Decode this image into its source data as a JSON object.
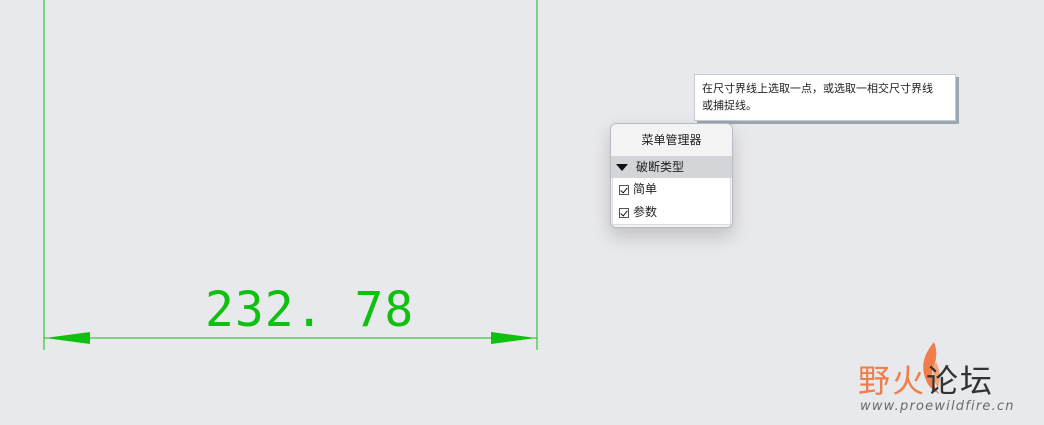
{
  "drawing": {
    "dimension_value": "232. 78",
    "line_color": "#10c010"
  },
  "tooltip": {
    "line1": "在尺寸界线上选取一点，或选取一相交尺寸界线",
    "line2": "或捕捉线。"
  },
  "menu_manager": {
    "title": "菜单管理器",
    "section": "破断类型",
    "items": [
      {
        "label": "简单",
        "checked": true
      },
      {
        "label": "参数",
        "checked": true
      }
    ]
  },
  "watermark": {
    "name_part1": "野火",
    "name_part2": "论坛",
    "url": "www.proewildfire.cn"
  }
}
